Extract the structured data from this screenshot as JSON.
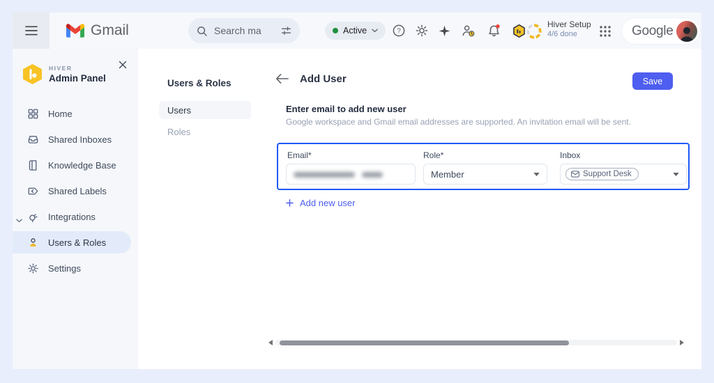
{
  "topbar": {
    "gmail_label": "Gmail",
    "search": {
      "placeholder": "Search ma"
    },
    "status": {
      "label": "Active"
    },
    "hiver_setup": {
      "title": "Hiver Setup",
      "progress": "4/6 done"
    },
    "google_label": "Google"
  },
  "sidebar": {
    "brand": {
      "eyebrow": "HIVER",
      "title": "Admin Panel"
    },
    "items": [
      {
        "label": "Home",
        "selected": false
      },
      {
        "label": "Shared Inboxes",
        "selected": false
      },
      {
        "label": "Knowledge Base",
        "selected": false
      },
      {
        "label": "Shared Labels",
        "selected": false
      },
      {
        "label": "Integrations",
        "selected": false,
        "expanded": true
      },
      {
        "label": "Users & Roles",
        "selected": true
      },
      {
        "label": "Settings",
        "selected": false
      }
    ]
  },
  "subnav": {
    "title": "Users & Roles",
    "items": [
      {
        "label": "Users",
        "selected": true
      },
      {
        "label": "Roles",
        "selected": false
      }
    ]
  },
  "main": {
    "title": "Add User",
    "save_label": "Save",
    "section_title": "Enter email to add new user",
    "section_subtitle": "Google workspace and Gmail email addresses are supported. An invitation email will be sent.",
    "form": {
      "email_label": "Email*",
      "role_label": "Role*",
      "role_value": "Member",
      "inbox_label": "Inbox",
      "inbox_value": "Support Desk"
    },
    "add_new_user_label": "Add new user"
  },
  "colors": {
    "accent_blue": "#4e5ef0",
    "form_border": "#1e5af5",
    "hiver_yellow": "#f7c325",
    "active_green": "#1e8e3e",
    "alert_red": "#ea4335"
  }
}
